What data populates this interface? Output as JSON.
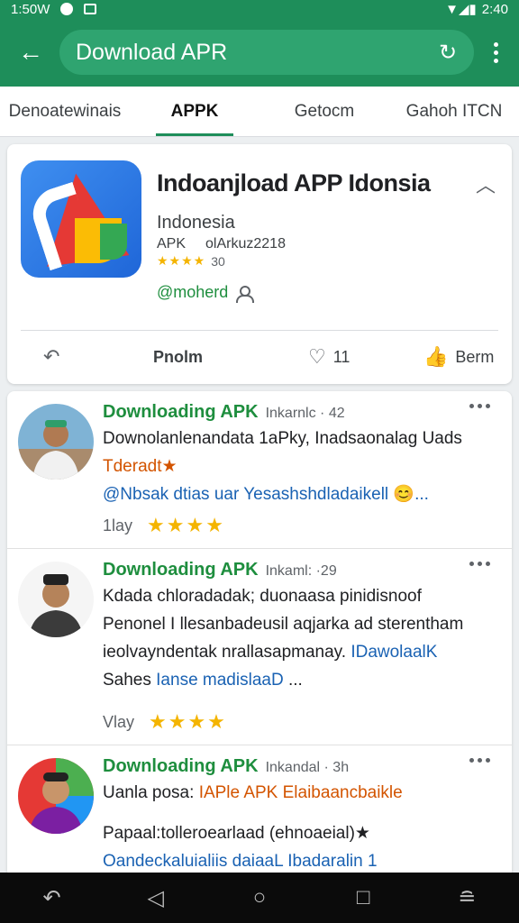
{
  "status_bar": {
    "time_left": "1:50W",
    "time_right": "2:40"
  },
  "search": {
    "text": "Download APR"
  },
  "tabs": [
    {
      "label": "Denoatewinais"
    },
    {
      "label": "APPK"
    },
    {
      "label": "Getocm"
    },
    {
      "label": "Gahoh ITCN"
    }
  ],
  "app": {
    "title": "Indoanjload APP Idonsia",
    "subtitle": "Indonesia",
    "meta_type": "APK",
    "meta_version": "olArkuz2218",
    "rating_stars": 4,
    "rating_text": "30",
    "developer": "@moherd"
  },
  "actions": {
    "primary": "Pnolm",
    "like_count": "11",
    "thumb_label": "Berm"
  },
  "reviews": [
    {
      "name": "Downloading APK",
      "meta": "Inkarnlc · 42",
      "line1": "Downolanlenandata 1aPky, Inadsaonalag Uads",
      "line2_orange": "Tderadt★",
      "line3_blue": "@Nbsak dtias uar Yesashshdladaikell 😊...",
      "date": "1lay",
      "stars": 4
    },
    {
      "name": "Downloading APK",
      "meta": "Inkaml: ·29",
      "line1": "Kdada chloradadak; duonaasa pinidisnoof",
      "line2": "Penonel I llesanbadeusil aqjarka ad sterentham",
      "line3": "ieolvayndentak nrallasapmanay.",
      "line3_blue": "IDawolaalK",
      "line4_a": "Sahes",
      "line4_blue": "Ianse madislaaD",
      "line4_b": "...",
      "date": "Vlay",
      "stars": 4
    },
    {
      "name": "Downloading APK",
      "meta": "Inkandal · 3h",
      "line1_a": "Uanla posa:",
      "line1_orange": "IAPle APK Elaibaancbaikle",
      "line2": "Papaal:tolleroearlaad (ehnoaeial)★",
      "line3_blue": "Oandeckaluialiis daiaaL Ibadaralin 1"
    }
  ],
  "colors": {
    "brand": "#1e8e5a",
    "accent_green": "#1e8e3e",
    "star": "#f4b400",
    "link_blue": "#1a62b3",
    "orange": "#d35400"
  }
}
